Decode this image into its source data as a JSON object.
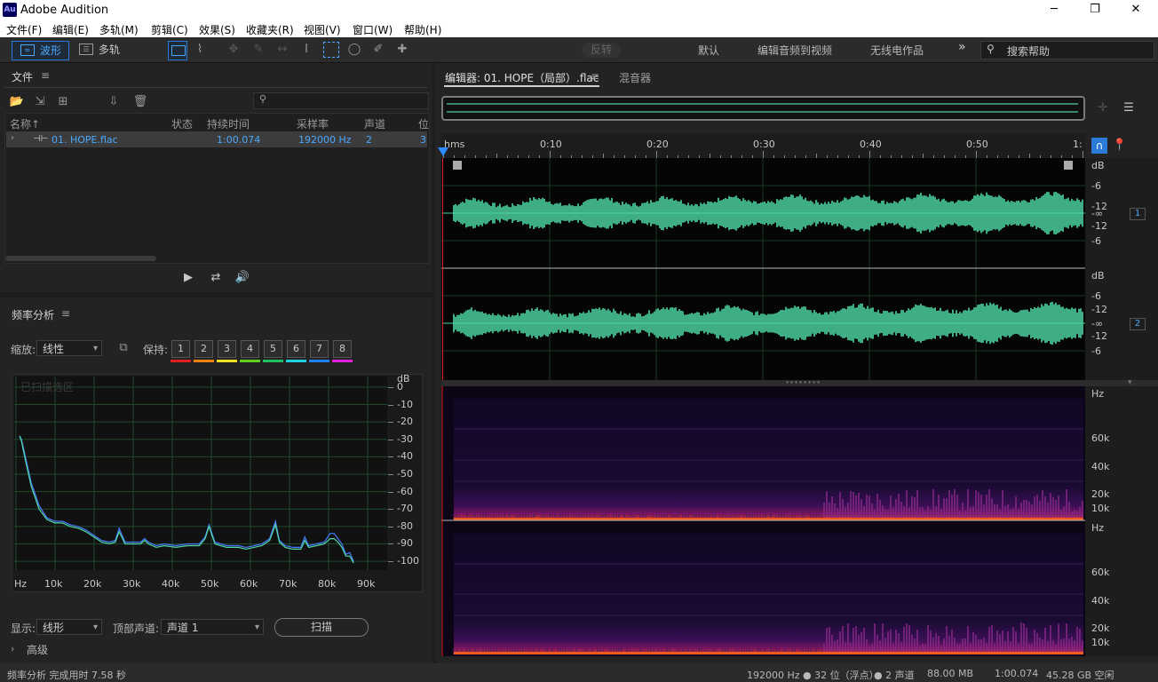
{
  "window": {
    "title": "Adobe Audition",
    "icon_text": "Au",
    "minimize": "─",
    "maximize": "❐",
    "close": "✕"
  },
  "menu": [
    "文件(F)",
    "编辑(E)",
    "多轨(M)",
    "剪辑(C)",
    "效果(S)",
    "收藏夹(R)",
    "视图(V)",
    "窗口(W)",
    "帮助(H)"
  ],
  "toolbar": {
    "waveform_label": "波形",
    "multitrack_label": "多轨",
    "reverse_label": "反转",
    "workspaces": [
      "默认",
      "编辑音频到视频",
      "无线电作品"
    ],
    "more": "»",
    "search_placeholder": "搜索帮助"
  },
  "files_panel": {
    "title": "文件",
    "menu_icon": "≡",
    "columns": [
      "名称↑",
      "状态",
      "持续时间",
      "采样率",
      "声道",
      "位"
    ],
    "file": {
      "name": "01. HOPE.flac",
      "status": "",
      "duration": "1:00.074",
      "sample_rate": "192000 Hz",
      "channels": "2",
      "bits": "3"
    }
  },
  "freq_panel": {
    "title": "频率分析",
    "zoom_label": "缩放:",
    "zoom_value": "线性",
    "hold_label": "保持:",
    "hold_buttons": [
      "1",
      "2",
      "3",
      "4",
      "5",
      "6",
      "7",
      "8"
    ],
    "hold_colors": [
      "#e02020",
      "#f08010",
      "#f0e020",
      "#60d020",
      "#20c060",
      "#20d0e0",
      "#2080f0",
      "#e020e0"
    ],
    "watermark": "已扫描选区",
    "y_unit": "dB",
    "y_ticks": [
      "0",
      "-10",
      "-20",
      "-30",
      "-40",
      "-50",
      "-60",
      "-70",
      "-80",
      "-90",
      "-100"
    ],
    "x_ticks": [
      "Hz",
      "10k",
      "20k",
      "30k",
      "40k",
      "50k",
      "60k",
      "70k",
      "80k",
      "90k"
    ],
    "display_label": "显示:",
    "display_value": "线形",
    "top_channel_label": "顶部声道:",
    "top_channel_value": "声道 1",
    "scan_button": "扫描",
    "advanced_label": "高级"
  },
  "chart_data": {
    "type": "line",
    "xlabel": "Hz",
    "ylabel": "dB",
    "xlim": [
      0,
      95000
    ],
    "ylim": [
      -103,
      3
    ],
    "x_ticks": [
      "Hz",
      "10k",
      "20k",
      "30k",
      "40k",
      "50k",
      "60k",
      "70k",
      "80k",
      "90k"
    ],
    "y_ticks": [
      0,
      -10,
      -20,
      -30,
      -40,
      -50,
      -60,
      -70,
      -80,
      -90,
      -100
    ],
    "grid": true,
    "series": [
      {
        "color": "#4a7aff",
        "x": [
          0,
          500,
          1500,
          3000,
          5000,
          7000,
          9000,
          11000,
          13000,
          15000,
          17000,
          19000,
          21000,
          23000,
          24500,
          25500,
          27000,
          29000,
          31000,
          32000,
          33000,
          35000,
          37000,
          40000,
          43000,
          46000,
          47500,
          48500,
          50000,
          53000,
          56000,
          58000,
          60000,
          62000,
          64000,
          65500,
          66500,
          68000,
          70000,
          72000,
          73000,
          74000,
          76000,
          78000,
          79500,
          80500,
          81500,
          82500,
          83500,
          84500,
          85500
        ],
        "y": [
          -28,
          -30,
          -40,
          -55,
          -68,
          -75,
          -77,
          -77,
          -79,
          -80,
          -82,
          -85,
          -88,
          -89,
          -88,
          -81,
          -89,
          -89,
          -89,
          -87,
          -89,
          -91,
          -90,
          -91,
          -90,
          -90,
          -86,
          -79,
          -89,
          -91,
          -91,
          -92,
          -91,
          -90,
          -87,
          -77,
          -88,
          -91,
          -92,
          -92,
          -86,
          -91,
          -90,
          -89,
          -84,
          -84,
          -87,
          -90,
          -96,
          -95,
          -100
        ]
      },
      {
        "color": "#4ed9a5",
        "x": [
          0,
          500,
          1500,
          3000,
          5000,
          7000,
          9000,
          11000,
          13000,
          15000,
          17000,
          19000,
          21000,
          23000,
          24500,
          25500,
          27000,
          29000,
          31000,
          32000,
          33000,
          35000,
          37000,
          40000,
          43000,
          46000,
          47500,
          48500,
          50000,
          53000,
          56000,
          58000,
          60000,
          62000,
          64000,
          65500,
          66500,
          68000,
          70000,
          72000,
          73000,
          74000,
          76000,
          78000,
          79500,
          80500,
          81500,
          82500,
          83500,
          84500,
          85500
        ],
        "y": [
          -28,
          -31,
          -42,
          -57,
          -70,
          -76,
          -78,
          -78,
          -80,
          -81,
          -83,
          -86,
          -89,
          -90,
          -89,
          -83,
          -90,
          -90,
          -90,
          -88,
          -90,
          -92,
          -91,
          -92,
          -91,
          -91,
          -87,
          -80,
          -90,
          -92,
          -92,
          -93,
          -92,
          -91,
          -88,
          -79,
          -89,
          -92,
          -93,
          -93,
          -88,
          -92,
          -91,
          -90,
          -87,
          -87,
          -89,
          -92,
          -97,
          -97,
          -101
        ]
      }
    ]
  },
  "editor": {
    "tab_label": "编辑器: 01. HOPE（局部）.flac",
    "tab_menu": "≡",
    "mixer_label": "混音器",
    "ruler": [
      "hms",
      "0:10",
      "0:20",
      "0:30",
      "0:40",
      "0:50",
      "1:"
    ],
    "db_labels": [
      "dB",
      "-6",
      "-12",
      "-∞",
      "-12",
      "-6"
    ],
    "channels": [
      "1",
      "2"
    ],
    "hz_labels": [
      "Hz",
      "60k",
      "40k",
      "20k",
      "10k"
    ]
  },
  "status": {
    "left": "频率分析 完成用时 7.58 秒",
    "format": "192000 Hz ● 32 位（浮点）",
    "channels": "● 2 声道",
    "memory": "88.00 MB",
    "duration": "1:00.074",
    "free": "45.28 GB 空闲"
  }
}
